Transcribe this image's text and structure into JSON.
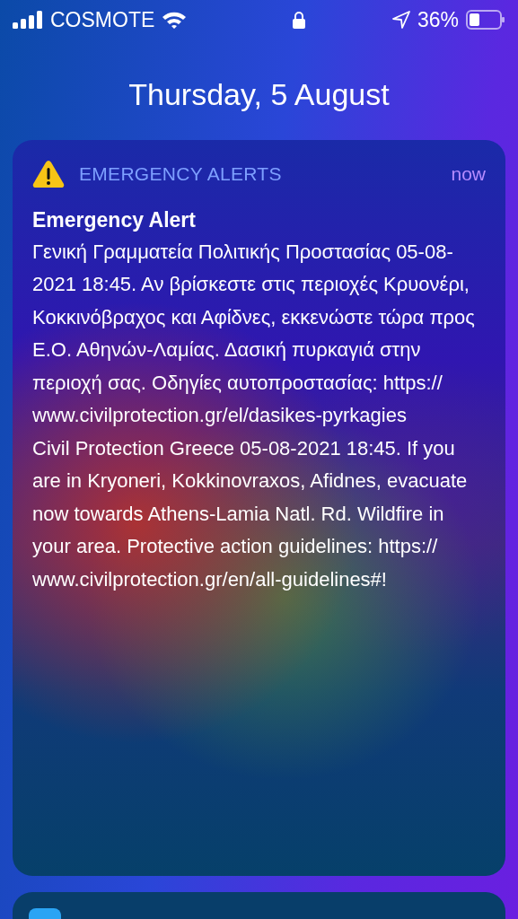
{
  "status_bar": {
    "carrier": "COSMOTE",
    "battery_text": "36%"
  },
  "date": "Thursday, 5 August",
  "notification": {
    "app": "EMERGENCY ALERTS",
    "time": "now",
    "title": "Emergency Alert",
    "paragraphs": [
      "Γενική Γραμματεία Πολιτικής Προστασίας 05-08-2021 18:45. Αν βρίσκεστε στις περιοχές Κρυονέρι, Κοκκινόβραχος και Αφίδνες, εκκενώστε τώρα προς Ε.Ο. Αθηνών-Λαμίας. Δασική πυρκαγιά στην περιοχή σας. Οδηγίες αυτοπροστασίας: https:// www.civilprotection.gr/el/dasikes-pyrkagies",
      "Civil Protection Greece 05-08-2021 18:45. If you are in Kryoneri, Kokkinovraxos, Afidnes, evacuate now towards Athens-Lamia Natl. Rd. Wildfire in your area. Protective action guidelines: https:// www.civilprotection.gr/en/all-guidelines#!"
    ]
  }
}
